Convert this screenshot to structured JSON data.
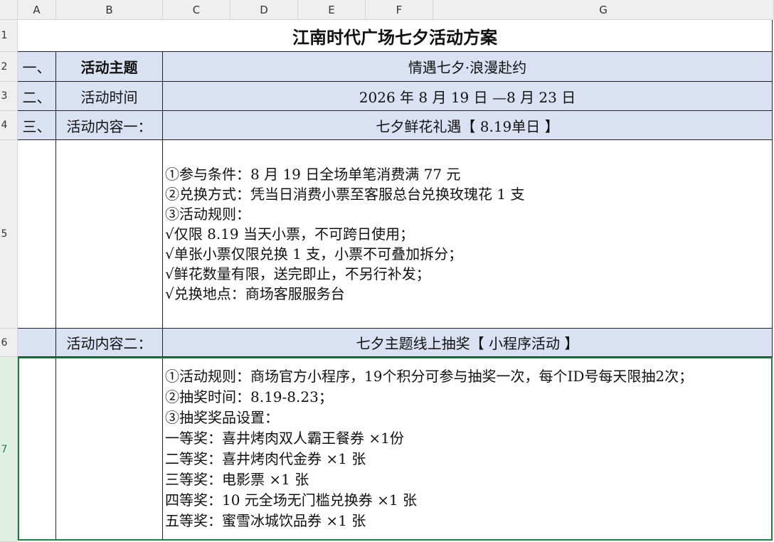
{
  "columns": [
    "A",
    "B",
    "C",
    "D",
    "E",
    "F",
    "G"
  ],
  "rows": [
    "1",
    "2",
    "3",
    "4",
    "5",
    "6",
    "7"
  ],
  "title": "江南时代广场七夕活动方案",
  "row2": {
    "num": "一、",
    "label": "活动主题",
    "value": "情遇七夕·浪漫赴约"
  },
  "row3": {
    "num": "二、",
    "label": "活动时间",
    "value": "2026 年 8 月 19 日 —8 月 23 日"
  },
  "row4": {
    "num": "三、",
    "label": "活动内容一：",
    "value": "七夕鲜花礼遇【 8.19单日 】"
  },
  "row5": {
    "lines": [
      "①参与条件：8 月 19 日全场单笔消费满 77 元",
      "②兑换方式：凭当日消费小票至客服总台兑换玫瑰花 1 支",
      "③活动规则：",
      "√仅限 8.19 当天小票，不可跨日使用；",
      "√单张小票仅限兑换 1 支，小票不可叠加拆分；",
      "√鲜花数量有限，送完即止，不另行补发；",
      "√兑换地点：商场客服服务台"
    ]
  },
  "row6": {
    "label": "活动内容二：",
    "value": "七夕主题线上抽奖【 小程序活动 】"
  },
  "row7": {
    "lines": [
      "①活动规则：商场官方小程序，19个积分可参与抽奖一次，每个ID号每天限抽2次；",
      "②抽奖时间：8.19-8.23；",
      "③抽奖奖品设置：",
      "一等奖：喜井烤肉双人霸王餐券 ×1份",
      "二等奖：喜井烤肉代金券 ×1 张",
      "三等奖：电影票 ×1 张",
      "四等奖：10 元全场无门槛兑换券 ×1 张",
      "五等奖：蜜雪冰城饮品券 ×1 张"
    ]
  },
  "colors": {
    "header_fill": "#d9e1f2",
    "selection": "#1e7b45"
  }
}
